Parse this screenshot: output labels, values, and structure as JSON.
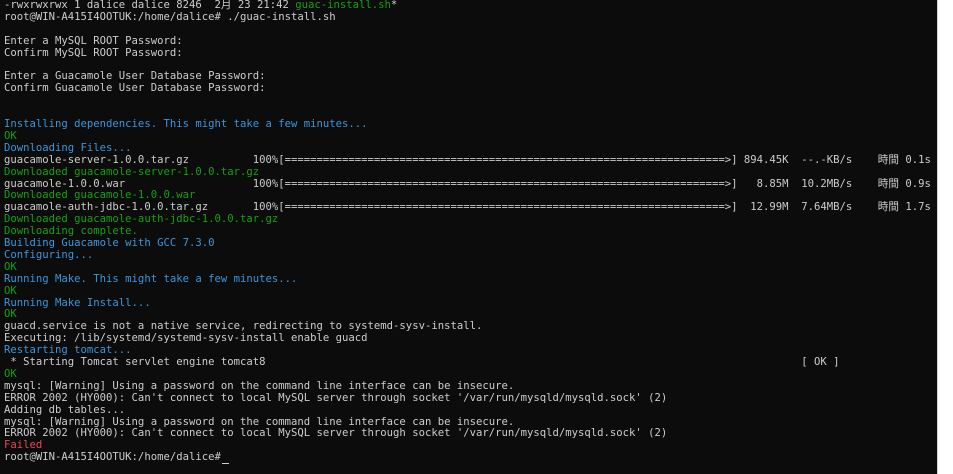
{
  "terminal": {
    "lines": [
      {
        "segments": [
          {
            "text": "-rwxrwxrwx 1 dalice dalice 8246  2月 23 21:42 ",
            "color": "default"
          },
          {
            "text": "guac-install.sh",
            "color": "green"
          },
          {
            "text": "*",
            "color": "default"
          }
        ]
      },
      {
        "segments": [
          {
            "text": "root@WIN-A415I4OOTUK:/home/dalice# ./guac-install.sh",
            "color": "default"
          }
        ]
      },
      {
        "segments": [
          {
            "text": "",
            "color": "default"
          }
        ]
      },
      {
        "segments": [
          {
            "text": "Enter a MySQL ROOT Password:",
            "color": "default"
          }
        ]
      },
      {
        "segments": [
          {
            "text": "Confirm MySQL ROOT Password:",
            "color": "default"
          }
        ]
      },
      {
        "segments": [
          {
            "text": "",
            "color": "default"
          }
        ]
      },
      {
        "segments": [
          {
            "text": "Enter a Guacamole User Database Password:",
            "color": "default"
          }
        ]
      },
      {
        "segments": [
          {
            "text": "Confirm Guacamole User Database Password:",
            "color": "default"
          }
        ]
      },
      {
        "segments": [
          {
            "text": "",
            "color": "default"
          }
        ]
      },
      {
        "segments": [
          {
            "text": "",
            "color": "default"
          }
        ]
      },
      {
        "segments": [
          {
            "text": "Installing dependencies. This might take a few minutes...",
            "color": "blue"
          }
        ]
      },
      {
        "segments": [
          {
            "text": "OK",
            "color": "green"
          }
        ]
      },
      {
        "segments": [
          {
            "text": "Downloading Files...",
            "color": "blue"
          }
        ]
      },
      {
        "segments": [
          {
            "text": "guacamole-server-1.0.0.tar.gz          100%[=====================================================================>] 894.45K  --.-KB/s    時間 0.1s",
            "color": "default"
          }
        ]
      },
      {
        "segments": [
          {
            "text": "Downloaded guacamole-server-1.0.0.tar.gz",
            "color": "green"
          }
        ]
      },
      {
        "segments": [
          {
            "text": "guacamole-1.0.0.war                    100%[=====================================================================>]   8.85M  10.2MB/s    時間 0.9s",
            "color": "default"
          }
        ]
      },
      {
        "segments": [
          {
            "text": "Downloaded guacamole-1.0.0.war",
            "color": "green"
          }
        ]
      },
      {
        "segments": [
          {
            "text": "guacamole-auth-jdbc-1.0.0.tar.gz       100%[=====================================================================>]  12.99M  7.64MB/s    時間 1.7s",
            "color": "default"
          }
        ]
      },
      {
        "segments": [
          {
            "text": "Downloaded guacamole-auth-jdbc-1.0.0.tar.gz",
            "color": "green"
          }
        ]
      },
      {
        "segments": [
          {
            "text": "Downloading complete.",
            "color": "green"
          }
        ]
      },
      {
        "segments": [
          {
            "text": "Building Guacamole with GCC 7.3.0",
            "color": "blue"
          }
        ]
      },
      {
        "segments": [
          {
            "text": "Configuring...",
            "color": "blue"
          }
        ]
      },
      {
        "segments": [
          {
            "text": "OK",
            "color": "green"
          }
        ]
      },
      {
        "segments": [
          {
            "text": "Running Make. This might take a few minutes...",
            "color": "blue"
          }
        ]
      },
      {
        "segments": [
          {
            "text": "OK",
            "color": "green"
          }
        ]
      },
      {
        "segments": [
          {
            "text": "Running Make Install...",
            "color": "blue"
          }
        ]
      },
      {
        "segments": [
          {
            "text": "OK",
            "color": "green"
          }
        ]
      },
      {
        "segments": [
          {
            "text": "guacd.service is not a native service, redirecting to systemd-sysv-install.",
            "color": "default"
          }
        ]
      },
      {
        "segments": [
          {
            "text": "Executing: /lib/systemd/systemd-sysv-install enable guacd",
            "color": "default"
          }
        ]
      },
      {
        "segments": [
          {
            "text": "Restarting tomcat...",
            "color": "blue"
          }
        ]
      },
      {
        "segments": [
          {
            "text": " * Starting Tomcat servlet engine tomcat8                                                                                    [ OK ]",
            "color": "default"
          }
        ]
      },
      {
        "segments": [
          {
            "text": "OK",
            "color": "green"
          }
        ]
      },
      {
        "segments": [
          {
            "text": "mysql: [Warning] Using a password on the command line interface can be insecure.",
            "color": "default"
          }
        ]
      },
      {
        "segments": [
          {
            "text": "ERROR 2002 (HY000): Can't connect to local MySQL server through socket '/var/run/mysqld/mysqld.sock' (2)",
            "color": "default"
          }
        ]
      },
      {
        "segments": [
          {
            "text": "Adding db tables...",
            "color": "default"
          }
        ]
      },
      {
        "segments": [
          {
            "text": "mysql: [Warning] Using a password on the command line interface can be insecure.",
            "color": "default"
          }
        ]
      },
      {
        "segments": [
          {
            "text": "ERROR 2002 (HY000): Can't connect to local MySQL server through socket '/var/run/mysqld/mysqld.sock' (2)",
            "color": "default"
          }
        ]
      },
      {
        "segments": [
          {
            "text": "Failed",
            "color": "red"
          }
        ]
      },
      {
        "segments": [
          {
            "text": "root@WIN-A415I4OOTUK:/home/dalice#",
            "color": "default"
          }
        ],
        "cursor": true
      }
    ]
  },
  "colors": {
    "background": "#0c0c0c",
    "default": "#cccccc",
    "blue": "#3a96dd",
    "green": "#13a10e",
    "red": "#e74856"
  }
}
